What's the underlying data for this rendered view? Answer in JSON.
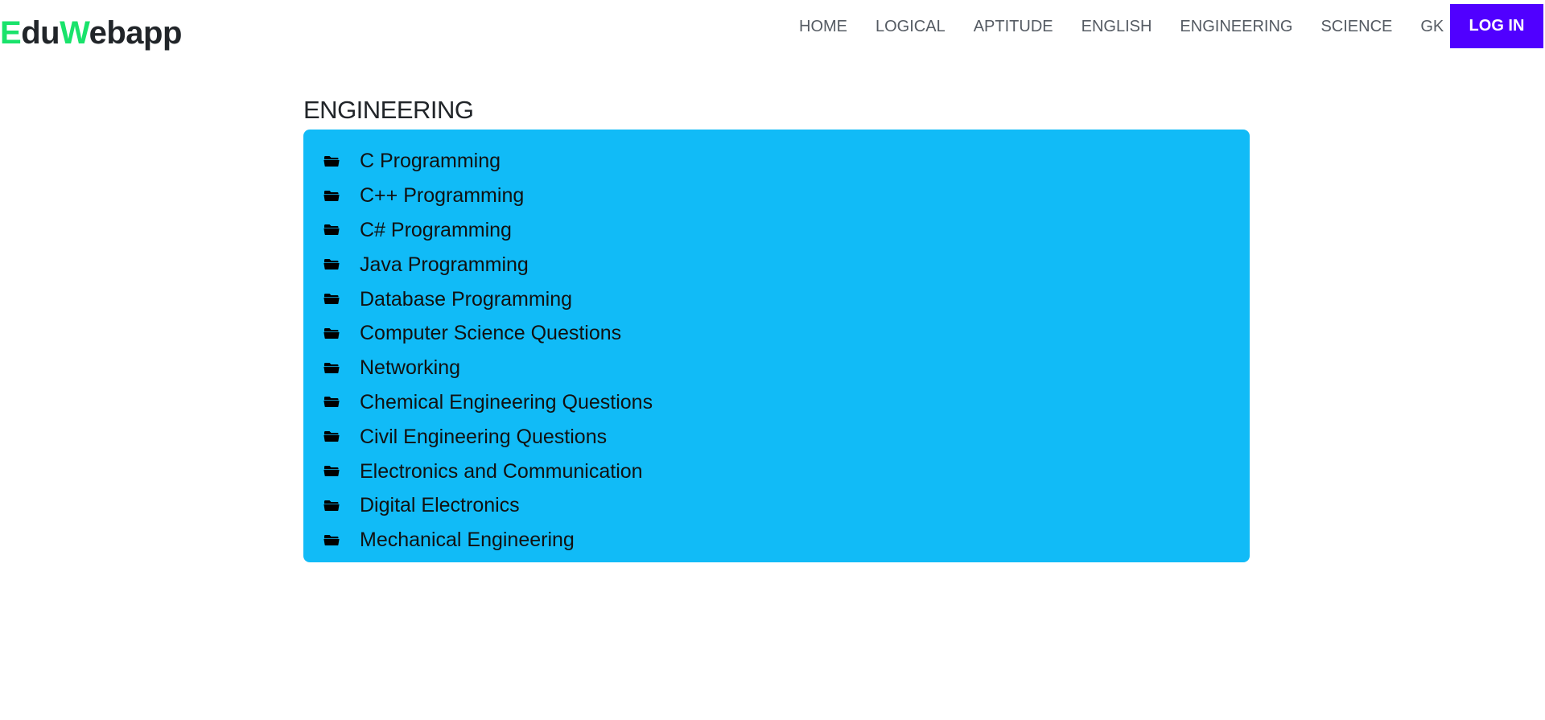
{
  "brand": {
    "letter1": "E",
    "part1": "du",
    "letter2": "W",
    "part2": "ebapp",
    "accent_color": "#19e36b"
  },
  "nav": {
    "items": [
      "HOME",
      "LOGICAL",
      "APTITUDE",
      "ENGLISH",
      "ENGINEERING",
      "SCIENCE",
      "GK"
    ],
    "login_label": "LOG IN",
    "login_color": "#5000ff"
  },
  "section": {
    "title": "ENGINEERING",
    "panel_color": "#11bbf7",
    "icon": "folder-icon",
    "items": [
      "C Programming",
      "C++ Programming",
      "C# Programming",
      "Java Programming",
      "Database Programming",
      "Computer Science Questions",
      "Networking",
      "Chemical Engineering Questions",
      "Civil Engineering Questions",
      "Electronics and Communication",
      "Digital Electronics",
      "Mechanical Engineering"
    ]
  }
}
